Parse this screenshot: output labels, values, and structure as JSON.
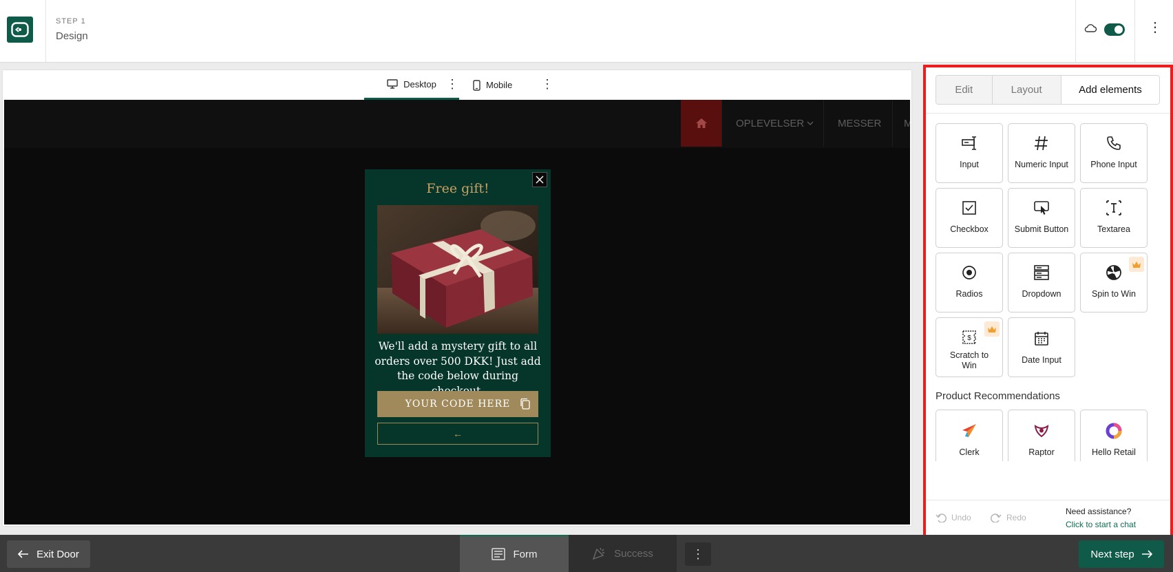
{
  "header": {
    "step_label": "STEP 1",
    "step_title": "Design"
  },
  "preview": {
    "device_tabs": [
      {
        "label": "Desktop",
        "active": true
      },
      {
        "label": "Mobile",
        "active": false
      }
    ],
    "site_nav": {
      "items": [
        "OPLEVELSER",
        "MESSER",
        "M"
      ]
    },
    "popup": {
      "title": "Free gift!",
      "body": "We'll add a mystery gift to all orders over 500 DKK! Just add the code below during checkout.",
      "code_placeholder": "YOUR CODE HERE",
      "back_glyph": "←"
    }
  },
  "panel": {
    "tabs": [
      {
        "label": "Edit",
        "active": false
      },
      {
        "label": "Layout",
        "active": false
      },
      {
        "label": "Add elements",
        "active": true
      }
    ],
    "elements": [
      {
        "label": "Input",
        "icon": "input-icon"
      },
      {
        "label": "Numeric Input",
        "icon": "hash-icon"
      },
      {
        "label": "Phone Input",
        "icon": "phone-icon"
      },
      {
        "label": "Checkbox",
        "icon": "checkbox-icon"
      },
      {
        "label": "Submit Button",
        "icon": "submit-click-icon"
      },
      {
        "label": "Textarea",
        "icon": "textarea-icon"
      },
      {
        "label": "Radios",
        "icon": "radio-icon"
      },
      {
        "label": "Dropdown",
        "icon": "dropdown-icon"
      },
      {
        "label": "Spin to Win",
        "icon": "wheel-icon",
        "premium": true
      },
      {
        "label": "Scratch to Win",
        "icon": "scratch-ticket-icon",
        "premium": true
      },
      {
        "label": "Date Input",
        "icon": "calendar-icon"
      }
    ],
    "section_title": "Product Recommendations",
    "recommendations": [
      {
        "label": "Clerk",
        "icon": "clerk-logo-icon"
      },
      {
        "label": "Raptor",
        "icon": "raptor-logo-icon"
      },
      {
        "label": "Hello Retail",
        "icon": "hello-retail-logo-icon"
      }
    ],
    "footer": {
      "undo": "Undo",
      "redo": "Redo",
      "assist_question": "Need assistance?",
      "assist_link": "Click to start a chat"
    }
  },
  "bottom": {
    "exit_label": "Exit Door",
    "steps": [
      {
        "label": "Form",
        "active": true
      },
      {
        "label": "Success",
        "active": false
      }
    ],
    "next_label": "Next step"
  },
  "colors": {
    "brand": "#0f5a48",
    "highlight_border": "#ee1c1c",
    "popup_bg": "#06362a",
    "popup_accent": "#c9a063"
  }
}
